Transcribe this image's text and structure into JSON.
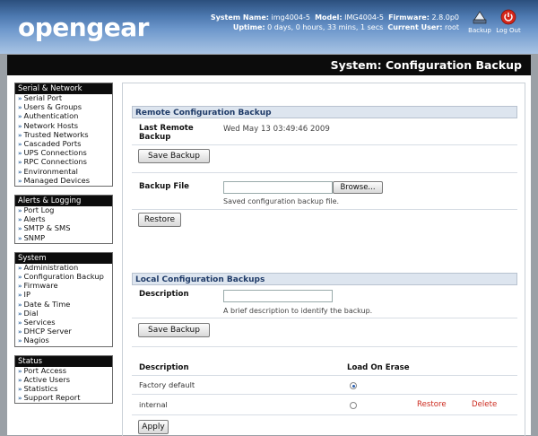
{
  "header": {
    "logo": "opengear",
    "system_name_label": "System Name:",
    "system_name": "img4004-5",
    "model_label": "Model:",
    "model": "IMG4004-5",
    "firmware_label": "Firmware:",
    "firmware": "2.8.0p0",
    "uptime_label": "Uptime:",
    "uptime": "0 days, 0 hours, 33 mins, 1 secs",
    "current_user_label": "Current User:",
    "current_user": "root",
    "backup_label": "Backup",
    "logout_label": "Log Out"
  },
  "title": "System: Configuration Backup",
  "sidebar": {
    "serial_network": {
      "heading": "Serial & Network",
      "items": [
        "Serial Port",
        "Users & Groups",
        "Authentication",
        "Network Hosts",
        "Trusted Networks",
        "Cascaded Ports",
        "UPS Connections",
        "RPC Connections",
        "Environmental",
        "Managed Devices"
      ]
    },
    "alerts_logging": {
      "heading": "Alerts & Logging",
      "items": [
        "Port Log",
        "Alerts",
        "SMTP & SMS",
        "SNMP"
      ]
    },
    "system": {
      "heading": "System",
      "items": [
        "Administration",
        "Configuration Backup",
        "Firmware",
        "IP",
        "Date & Time",
        "Dial",
        "Services",
        "DHCP Server",
        "Nagios"
      ]
    },
    "status": {
      "heading": "Status",
      "items": [
        "Port Access",
        "Active Users",
        "Statistics",
        "Support Report"
      ]
    },
    "arrow": "»"
  },
  "remote": {
    "heading": "Remote Configuration Backup",
    "last_backup_label": "Last Remote Backup",
    "last_backup_value": "Wed May 13 03:49:46 2009",
    "save_button": "Save Backup",
    "backup_file_label": "Backup File",
    "browse_button": "Browse...",
    "backup_file_hint": "Saved configuration backup file.",
    "restore_button": "Restore"
  },
  "local": {
    "heading": "Local Configuration Backups",
    "description_label": "Description",
    "description_hint": "A brief description to identify the backup.",
    "save_button": "Save Backup",
    "col_description": "Description",
    "col_load_on_erase": "Load On Erase",
    "rows": [
      {
        "description": "Factory default",
        "load_on_erase": true,
        "restore": "",
        "delete": ""
      },
      {
        "description": "internal",
        "load_on_erase": false,
        "restore": "Restore",
        "delete": "Delete"
      }
    ],
    "apply_button": "Apply"
  },
  "colors": {
    "accent": "#1f3b68",
    "link_red": "#cc2a1e",
    "title_bar": "#0c0c0c"
  }
}
